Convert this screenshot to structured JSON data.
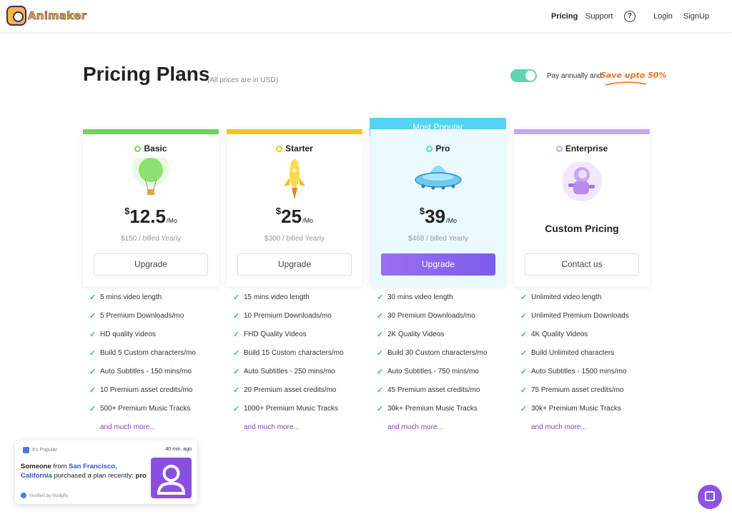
{
  "header": {
    "logo_text": "Animaker",
    "nav": {
      "pricing": "Pricing",
      "support": "Support",
      "help": "?",
      "login": "Login",
      "signup": "SignUp"
    }
  },
  "hero": {
    "title": "Pricing Plans",
    "subtitle": "(All prices are in USD)",
    "toggle_on": true,
    "pay_label": "Pay annually and",
    "save_label": "Save upto 50%"
  },
  "popular_label": "Most Popular",
  "plans": [
    {
      "name": "Basic",
      "accent": "#6ed45f",
      "currency": "$",
      "amount": "12.5",
      "per": "/Mo",
      "billed": "$150 / billed Yearly",
      "button": "Upgrade",
      "features": [
        "5 mins video length",
        "5 Premium Downloads/mo",
        "HD quality videos",
        "Build 5 Custom characters/mo",
        "Auto Subtitles - 150 mins/mo",
        "10 Premium asset credits/mo",
        "500+ Premium Music Tracks"
      ],
      "more": "and much more..."
    },
    {
      "name": "Starter",
      "accent": "#fcc419",
      "currency": "$",
      "amount": "25",
      "per": "/Mo",
      "billed": "$300 / billed Yearly",
      "button": "Upgrade",
      "features": [
        "15 mins video length",
        "10 Premium Downloads/mo",
        "FHD Quality Videos",
        "Build 15 Custom characters/mo",
        "Auto Subtitles - 250 mins/mo",
        "20 Premium asset credits/mo",
        "1000+ Premium Music Tracks"
      ],
      "more": "and much more..."
    },
    {
      "name": "Pro",
      "accent": "#54d4f5",
      "currency": "$",
      "amount": "39",
      "per": "/Mo",
      "billed": "$468 / billed Yearly",
      "button": "Upgrade",
      "features": [
        "30 mins video length",
        "30 Premium Downloads/mo",
        "2K Quality Videos",
        "Build 30 Custom characters/mo",
        "Auto Subtitles - 750 mins/mo",
        "45 Premium asset credits/mo",
        "30k+ Premium Music Tracks"
      ],
      "more": "and much more..."
    },
    {
      "name": "Enterprise",
      "accent": "#c9a6f5",
      "custom": "Custom Pricing",
      "button": "Contact us",
      "features": [
        "Unlimited video length",
        "Unlimited Premium Downloads",
        "4K Quality Videos",
        "Build Unlimited characters",
        "Auto Subtitles - 1500 mins/mo",
        "75 Premium asset credits/mo",
        "30k+ Premium Music Tracks"
      ],
      "more": "and much more..."
    }
  ],
  "toast": {
    "tag": "It's Popular",
    "time": "40 min. ago",
    "someone": "Someone",
    "from": "from",
    "location": "San Francisco, California",
    "action": "purchased a plan recently:",
    "plan": "pro",
    "verified": "Verified by Nudgify"
  }
}
